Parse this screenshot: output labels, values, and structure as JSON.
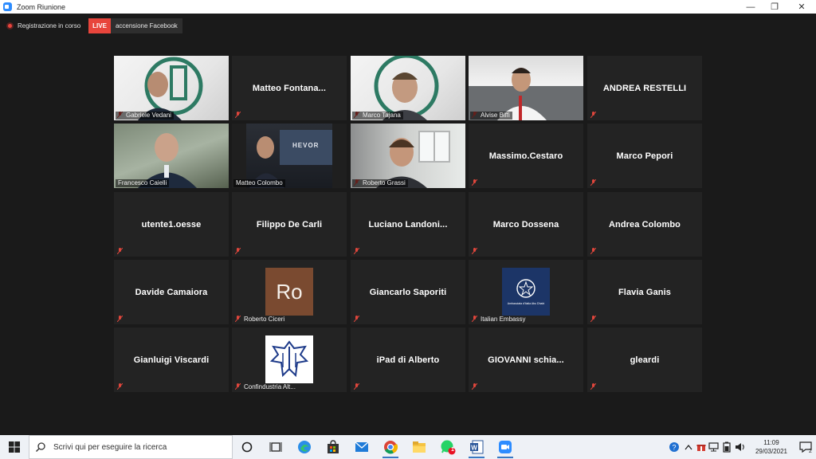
{
  "window": {
    "title": "Zoom Riunione",
    "min_symbol": "—",
    "max_symbol": "❐",
    "close_symbol": "✕"
  },
  "recording": {
    "status_text": "Registrazione in corso",
    "live_badge": "LIVE",
    "live_target": "accensione Facebook"
  },
  "participants": [
    {
      "name": "Gabriele Vedani",
      "type": "video",
      "muted": true
    },
    {
      "name": "Matteo  Fontana...",
      "type": "name",
      "muted": true
    },
    {
      "name": "Marco Tajana",
      "type": "video",
      "muted": true
    },
    {
      "name": "Alvise Biffi",
      "type": "video",
      "muted": true
    },
    {
      "name": "ANDREA RESTELLI",
      "type": "name",
      "muted": true
    },
    {
      "name": "Francesco Caielli",
      "type": "video",
      "muted": false,
      "active_speaker": true
    },
    {
      "name": "Matteo Colombo",
      "type": "video",
      "muted": false,
      "screen_text": "HEVOR"
    },
    {
      "name": "Roberto Grassi",
      "type": "video",
      "muted": true
    },
    {
      "name": "Massimo.Cestaro",
      "type": "name",
      "muted": true
    },
    {
      "name": "Marco Pepori",
      "type": "name",
      "muted": true
    },
    {
      "name": "utente1.oesse",
      "type": "name",
      "muted": true
    },
    {
      "name": "Filippo De Carli",
      "type": "name",
      "muted": true
    },
    {
      "name": "Luciano  Landoni...",
      "type": "name",
      "muted": true
    },
    {
      "name": "Marco Dossena",
      "type": "name",
      "muted": true
    },
    {
      "name": "Andrea Colombo",
      "type": "name",
      "muted": true
    },
    {
      "name": "Davide Camaiora",
      "type": "name",
      "muted": true
    },
    {
      "name": "Roberto Ciceri",
      "type": "avatar",
      "avatar_text": "Ro",
      "muted": true
    },
    {
      "name": "Giancarlo Saporiti",
      "type": "name",
      "muted": true
    },
    {
      "name": "Italian Embassy",
      "type": "avatar",
      "avatar_text": "Ambasciata d'Italia Abu Dhabi",
      "muted": true
    },
    {
      "name": "Flavia Ganis",
      "type": "name",
      "muted": true
    },
    {
      "name": "Gianluigi Viscardi",
      "type": "name",
      "muted": true
    },
    {
      "name": "Confindustria Alt...",
      "type": "avatar",
      "muted": true
    },
    {
      "name": "iPad di Alberto",
      "type": "name",
      "muted": true
    },
    {
      "name": "GIOVANNI  schia...",
      "type": "name",
      "muted": true
    },
    {
      "name": "gleardi",
      "type": "name",
      "muted": true
    }
  ],
  "taskbar": {
    "search_placeholder": "Scrivi qui per eseguire la ricerca",
    "time": "11:09",
    "date": "29/03/2021",
    "notification_count": "2",
    "badge_count": "1"
  },
  "colors": {
    "background": "#1a1a1a",
    "tile": "#232323",
    "live_red": "#e8453c",
    "active_speaker": "#c8d42a",
    "muted_red": "#e0463c"
  }
}
